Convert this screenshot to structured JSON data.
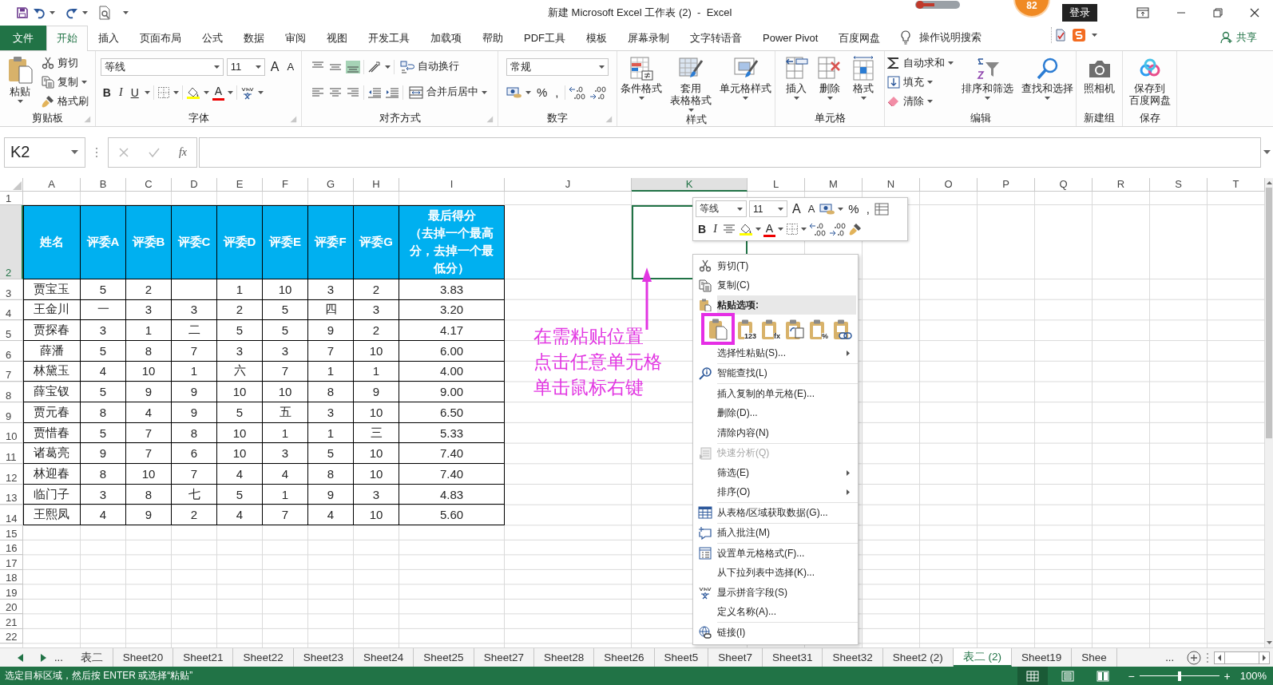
{
  "title_bar": {
    "title": "新建 Microsoft Excel 工作表 (2)  -  Excel",
    "badge": "82",
    "login": "登录"
  },
  "menu_tabs": [
    {
      "label": "文件",
      "kind": "file",
      "selected": false
    },
    {
      "label": "开始",
      "kind": "tab",
      "selected": true
    },
    {
      "label": "插入",
      "kind": "tab",
      "selected": false
    },
    {
      "label": "页面布局",
      "kind": "tab",
      "selected": false
    },
    {
      "label": "公式",
      "kind": "tab",
      "selected": false
    },
    {
      "label": "数据",
      "kind": "tab",
      "selected": false
    },
    {
      "label": "审阅",
      "kind": "tab",
      "selected": false
    },
    {
      "label": "视图",
      "kind": "tab",
      "selected": false
    },
    {
      "label": "开发工具",
      "kind": "tab",
      "selected": false
    },
    {
      "label": "加载项",
      "kind": "tab",
      "selected": false
    },
    {
      "label": "帮助",
      "kind": "tab",
      "selected": false
    },
    {
      "label": "PDF工具",
      "kind": "tab",
      "selected": false
    },
    {
      "label": "模板",
      "kind": "tab",
      "selected": false
    },
    {
      "label": "屏幕录制",
      "kind": "tab",
      "selected": false
    },
    {
      "label": "文字转语音",
      "kind": "tab",
      "selected": false
    },
    {
      "label": "Power Pivot",
      "kind": "tab",
      "selected": false
    },
    {
      "label": "百度网盘",
      "kind": "tab",
      "selected": false
    }
  ],
  "tell_me": "操作说明搜索",
  "share": "共享",
  "ribbon": [
    {
      "kind": "clipboard",
      "label": "剪贴板",
      "launcher": true,
      "paste": "粘贴",
      "small": [
        "剪切",
        "复制",
        "格式刷"
      ]
    },
    {
      "kind": "font",
      "label": "字体",
      "launcher": true,
      "font": "等线",
      "size": "11",
      "grow": "A",
      "shrink": "A",
      "bold": "B",
      "italic": "I",
      "underline": "U",
      "font_color": "A"
    },
    {
      "kind": "alignment",
      "label": "对齐方式",
      "launcher": true,
      "vertical_align": [
        {
          "selected": false
        },
        {
          "selected": false
        },
        {
          "selected": true
        }
      ],
      "wrap": "自动换行",
      "merge": "合并后居中"
    },
    {
      "kind": "number",
      "label": "数字",
      "launcher": true,
      "format": "常规",
      "percent": "%",
      "comma": ","
    },
    {
      "kind": "large",
      "label": "样式",
      "launcher": false,
      "items": [
        [
          "条件格式"
        ],
        [
          "套用",
          "表格格式"
        ],
        [
          "单元格样式"
        ]
      ]
    },
    {
      "kind": "large",
      "label": "单元格",
      "launcher": false,
      "items": [
        [
          "插入"
        ],
        [
          "删除"
        ],
        [
          "格式"
        ]
      ]
    },
    {
      "kind": "editing",
      "label": "编辑",
      "launcher": false,
      "small": [
        "自动求和",
        "填充",
        "清除"
      ],
      "items": [
        [
          "排序和筛选"
        ],
        [
          "查找和选择"
        ]
      ]
    },
    {
      "kind": "large",
      "label": "新建组",
      "launcher": false,
      "items": [
        [
          "照相机"
        ]
      ]
    },
    {
      "kind": "large",
      "label": "保存",
      "launcher": false,
      "items": [
        [
          "保存到",
          "百度网盘"
        ]
      ]
    }
  ],
  "formula_bar": {
    "name_box": "K2",
    "fx": "fx"
  },
  "sheet": {
    "columns": [
      {
        "label": "A",
        "selected": false
      },
      {
        "label": "B",
        "selected": false
      },
      {
        "label": "C",
        "selected": false
      },
      {
        "label": "D",
        "selected": false
      },
      {
        "label": "E",
        "selected": false
      },
      {
        "label": "F",
        "selected": false
      },
      {
        "label": "G",
        "selected": false
      },
      {
        "label": "H",
        "selected": false
      },
      {
        "label": "I",
        "selected": false
      },
      {
        "label": "J",
        "selected": false
      },
      {
        "label": "K",
        "selected": true
      },
      {
        "label": "L",
        "selected": false
      },
      {
        "label": "M",
        "selected": false
      },
      {
        "label": "N",
        "selected": false
      },
      {
        "label": "O",
        "selected": false
      },
      {
        "label": "P",
        "selected": false
      },
      {
        "label": "Q",
        "selected": false
      },
      {
        "label": "R",
        "selected": false
      },
      {
        "label": "S",
        "selected": false
      },
      {
        "label": "T",
        "selected": false
      }
    ],
    "rows": [
      {
        "label": "1",
        "selected": false
      },
      {
        "label": "2",
        "selected": true
      },
      {
        "label": "3",
        "selected": false
      },
      {
        "label": "4",
        "selected": false
      },
      {
        "label": "5",
        "selected": false
      },
      {
        "label": "6",
        "selected": false
      },
      {
        "label": "7",
        "selected": false
      },
      {
        "label": "8",
        "selected": false
      },
      {
        "label": "9",
        "selected": false
      },
      {
        "label": "10",
        "selected": false
      },
      {
        "label": "11",
        "selected": false
      },
      {
        "label": "12",
        "selected": false
      },
      {
        "label": "13",
        "selected": false
      },
      {
        "label": "14",
        "selected": false
      },
      {
        "label": "15",
        "selected": false
      },
      {
        "label": "16",
        "selected": false
      },
      {
        "label": "17",
        "selected": false
      },
      {
        "label": "18",
        "selected": false
      },
      {
        "label": "19",
        "selected": false
      },
      {
        "label": "20",
        "selected": false
      },
      {
        "label": "21",
        "selected": false
      },
      {
        "label": "22",
        "selected": false
      }
    ],
    "table": {
      "header": [
        "姓名",
        "评委A",
        "评委B",
        "评委C",
        "评委D",
        "评委E",
        "评委F",
        "评委G",
        [
          "最后得分",
          "（去掉一个最高",
          "分，去掉一个最",
          "低分）"
        ]
      ],
      "rows": [
        [
          "贾宝玉",
          "5",
          "2",
          null,
          "1",
          "10",
          "3",
          "2",
          "3.83"
        ],
        [
          "王金川",
          "一",
          "3",
          "3",
          "2",
          "5",
          "四",
          "3",
          "3.20"
        ],
        [
          "贾探春",
          "3",
          "1",
          "二",
          "5",
          "5",
          "9",
          "2",
          "4.17"
        ],
        [
          "薛潘",
          "5",
          "8",
          "7",
          "3",
          "3",
          "7",
          "10",
          "6.00"
        ],
        [
          "林黛玉",
          "4",
          "10",
          "1",
          "六",
          "7",
          "1",
          "1",
          "4.00"
        ],
        [
          "薛宝钗",
          "5",
          "9",
          "9",
          "10",
          "10",
          "8",
          "9",
          "9.00"
        ],
        [
          "贾元春",
          "8",
          "4",
          "9",
          "5",
          "五",
          "3",
          "10",
          "6.50"
        ],
        [
          "贾惜春",
          "5",
          "7",
          "8",
          "10",
          "1",
          "1",
          "三",
          "5.33"
        ],
        [
          "诸葛亮",
          "9",
          "7",
          "6",
          "10",
          "3",
          "5",
          "10",
          "7.40"
        ],
        [
          "林迎春",
          "8",
          "10",
          "7",
          "4",
          "4",
          "8",
          "10",
          "7.40"
        ],
        [
          "临门子",
          "3",
          "8",
          "七",
          "5",
          "1",
          "9",
          "3",
          "4.83"
        ],
        [
          "王熙凤",
          "4",
          "9",
          "2",
          "4",
          "7",
          "4",
          "10",
          "5.60"
        ]
      ]
    }
  },
  "annotation": {
    "lines": [
      "在需粘贴位置",
      "点击任意单元格",
      "单击鼠标右键"
    ]
  },
  "mini_toolbar": {
    "font": "等线",
    "size": "11",
    "grow": "A",
    "shrink": "A",
    "percent": "%",
    "comma": ",",
    "bold": "B",
    "italic": "I",
    "font_color": "A"
  },
  "context_menu": [
    {
      "kind": "item",
      "label": "剪切(T)",
      "disabled": false,
      "submenu": false
    },
    {
      "kind": "item",
      "label": "复制(C)",
      "disabled": false,
      "submenu": false
    },
    {
      "kind": "header",
      "label": "粘贴选项:"
    },
    {
      "kind": "paste",
      "options": [
        {
          "selected": true
        },
        {
          "selected": false,
          "label": "123"
        },
        {
          "selected": false,
          "label": "fx"
        },
        {
          "selected": false
        },
        {
          "selected": false,
          "label": "%"
        },
        {
          "selected": false
        }
      ]
    },
    {
      "kind": "item",
      "label": "选择性粘贴(S)...",
      "disabled": false,
      "submenu": true
    },
    {
      "kind": "separator"
    },
    {
      "kind": "item",
      "label": "智能查找(L)",
      "disabled": false,
      "submenu": false
    },
    {
      "kind": "separator"
    },
    {
      "kind": "item",
      "label": "插入复制的单元格(E)...",
      "disabled": false,
      "submenu": false
    },
    {
      "kind": "item",
      "label": "删除(D)...",
      "disabled": false,
      "submenu": false
    },
    {
      "kind": "item",
      "label": "清除内容(N)",
      "disabled": false,
      "submenu": false
    },
    {
      "kind": "separator"
    },
    {
      "kind": "item",
      "label": "快速分析(Q)",
      "disabled": true,
      "submenu": false
    },
    {
      "kind": "item",
      "label": "筛选(E)",
      "disabled": false,
      "submenu": true
    },
    {
      "kind": "item",
      "label": "排序(O)",
      "disabled": false,
      "submenu": true
    },
    {
      "kind": "separator"
    },
    {
      "kind": "item",
      "label": "从表格/区域获取数据(G)...",
      "disabled": false,
      "submenu": false
    },
    {
      "kind": "separator"
    },
    {
      "kind": "item",
      "label": "插入批注(M)",
      "disabled": false,
      "submenu": false
    },
    {
      "kind": "separator"
    },
    {
      "kind": "item",
      "label": "设置单元格格式(F)...",
      "disabled": false,
      "submenu": false
    },
    {
      "kind": "item",
      "label": "从下拉列表中选择(K)...",
      "disabled": false,
      "submenu": false
    },
    {
      "kind": "item",
      "label": "显示拼音字段(S)",
      "disabled": false,
      "submenu": false
    },
    {
      "kind": "item",
      "label": "定义名称(A)...",
      "disabled": false,
      "submenu": false
    },
    {
      "kind": "separator"
    },
    {
      "kind": "item",
      "label": "链接(I)",
      "disabled": false,
      "submenu": false
    }
  ],
  "sheet_tabs": {
    "more_left": "...",
    "tabs": [
      {
        "label": "表二",
        "selected": false
      },
      {
        "label": "Sheet20",
        "selected": false
      },
      {
        "label": "Sheet21",
        "selected": false
      },
      {
        "label": "Sheet22",
        "selected": false
      },
      {
        "label": "Sheet23",
        "selected": false
      },
      {
        "label": "Sheet24",
        "selected": false
      },
      {
        "label": "Sheet25",
        "selected": false
      },
      {
        "label": "Sheet27",
        "selected": false
      },
      {
        "label": "Sheet28",
        "selected": false
      },
      {
        "label": "Sheet26",
        "selected": false
      },
      {
        "label": "Sheet5",
        "selected": false
      },
      {
        "label": "Sheet7",
        "selected": false
      },
      {
        "label": "Sheet31",
        "selected": false
      },
      {
        "label": "Sheet32",
        "selected": false
      },
      {
        "label": "Sheet2 (2)",
        "selected": false
      },
      {
        "label": "表二 (2)",
        "selected": true
      },
      {
        "label": "Sheet19",
        "selected": false
      },
      {
        "label": "Shee",
        "selected": false
      }
    ],
    "more_right": "..."
  },
  "status_bar": {
    "message": "选定目标区域，然后按 ENTER 或选择“粘贴”",
    "views": [
      {
        "selected": true
      },
      {
        "selected": false
      },
      {
        "selected": false
      }
    ],
    "zoom": {
      "minus": "−",
      "plus": "+",
      "level": 0.5,
      "reading": "100%"
    }
  }
}
